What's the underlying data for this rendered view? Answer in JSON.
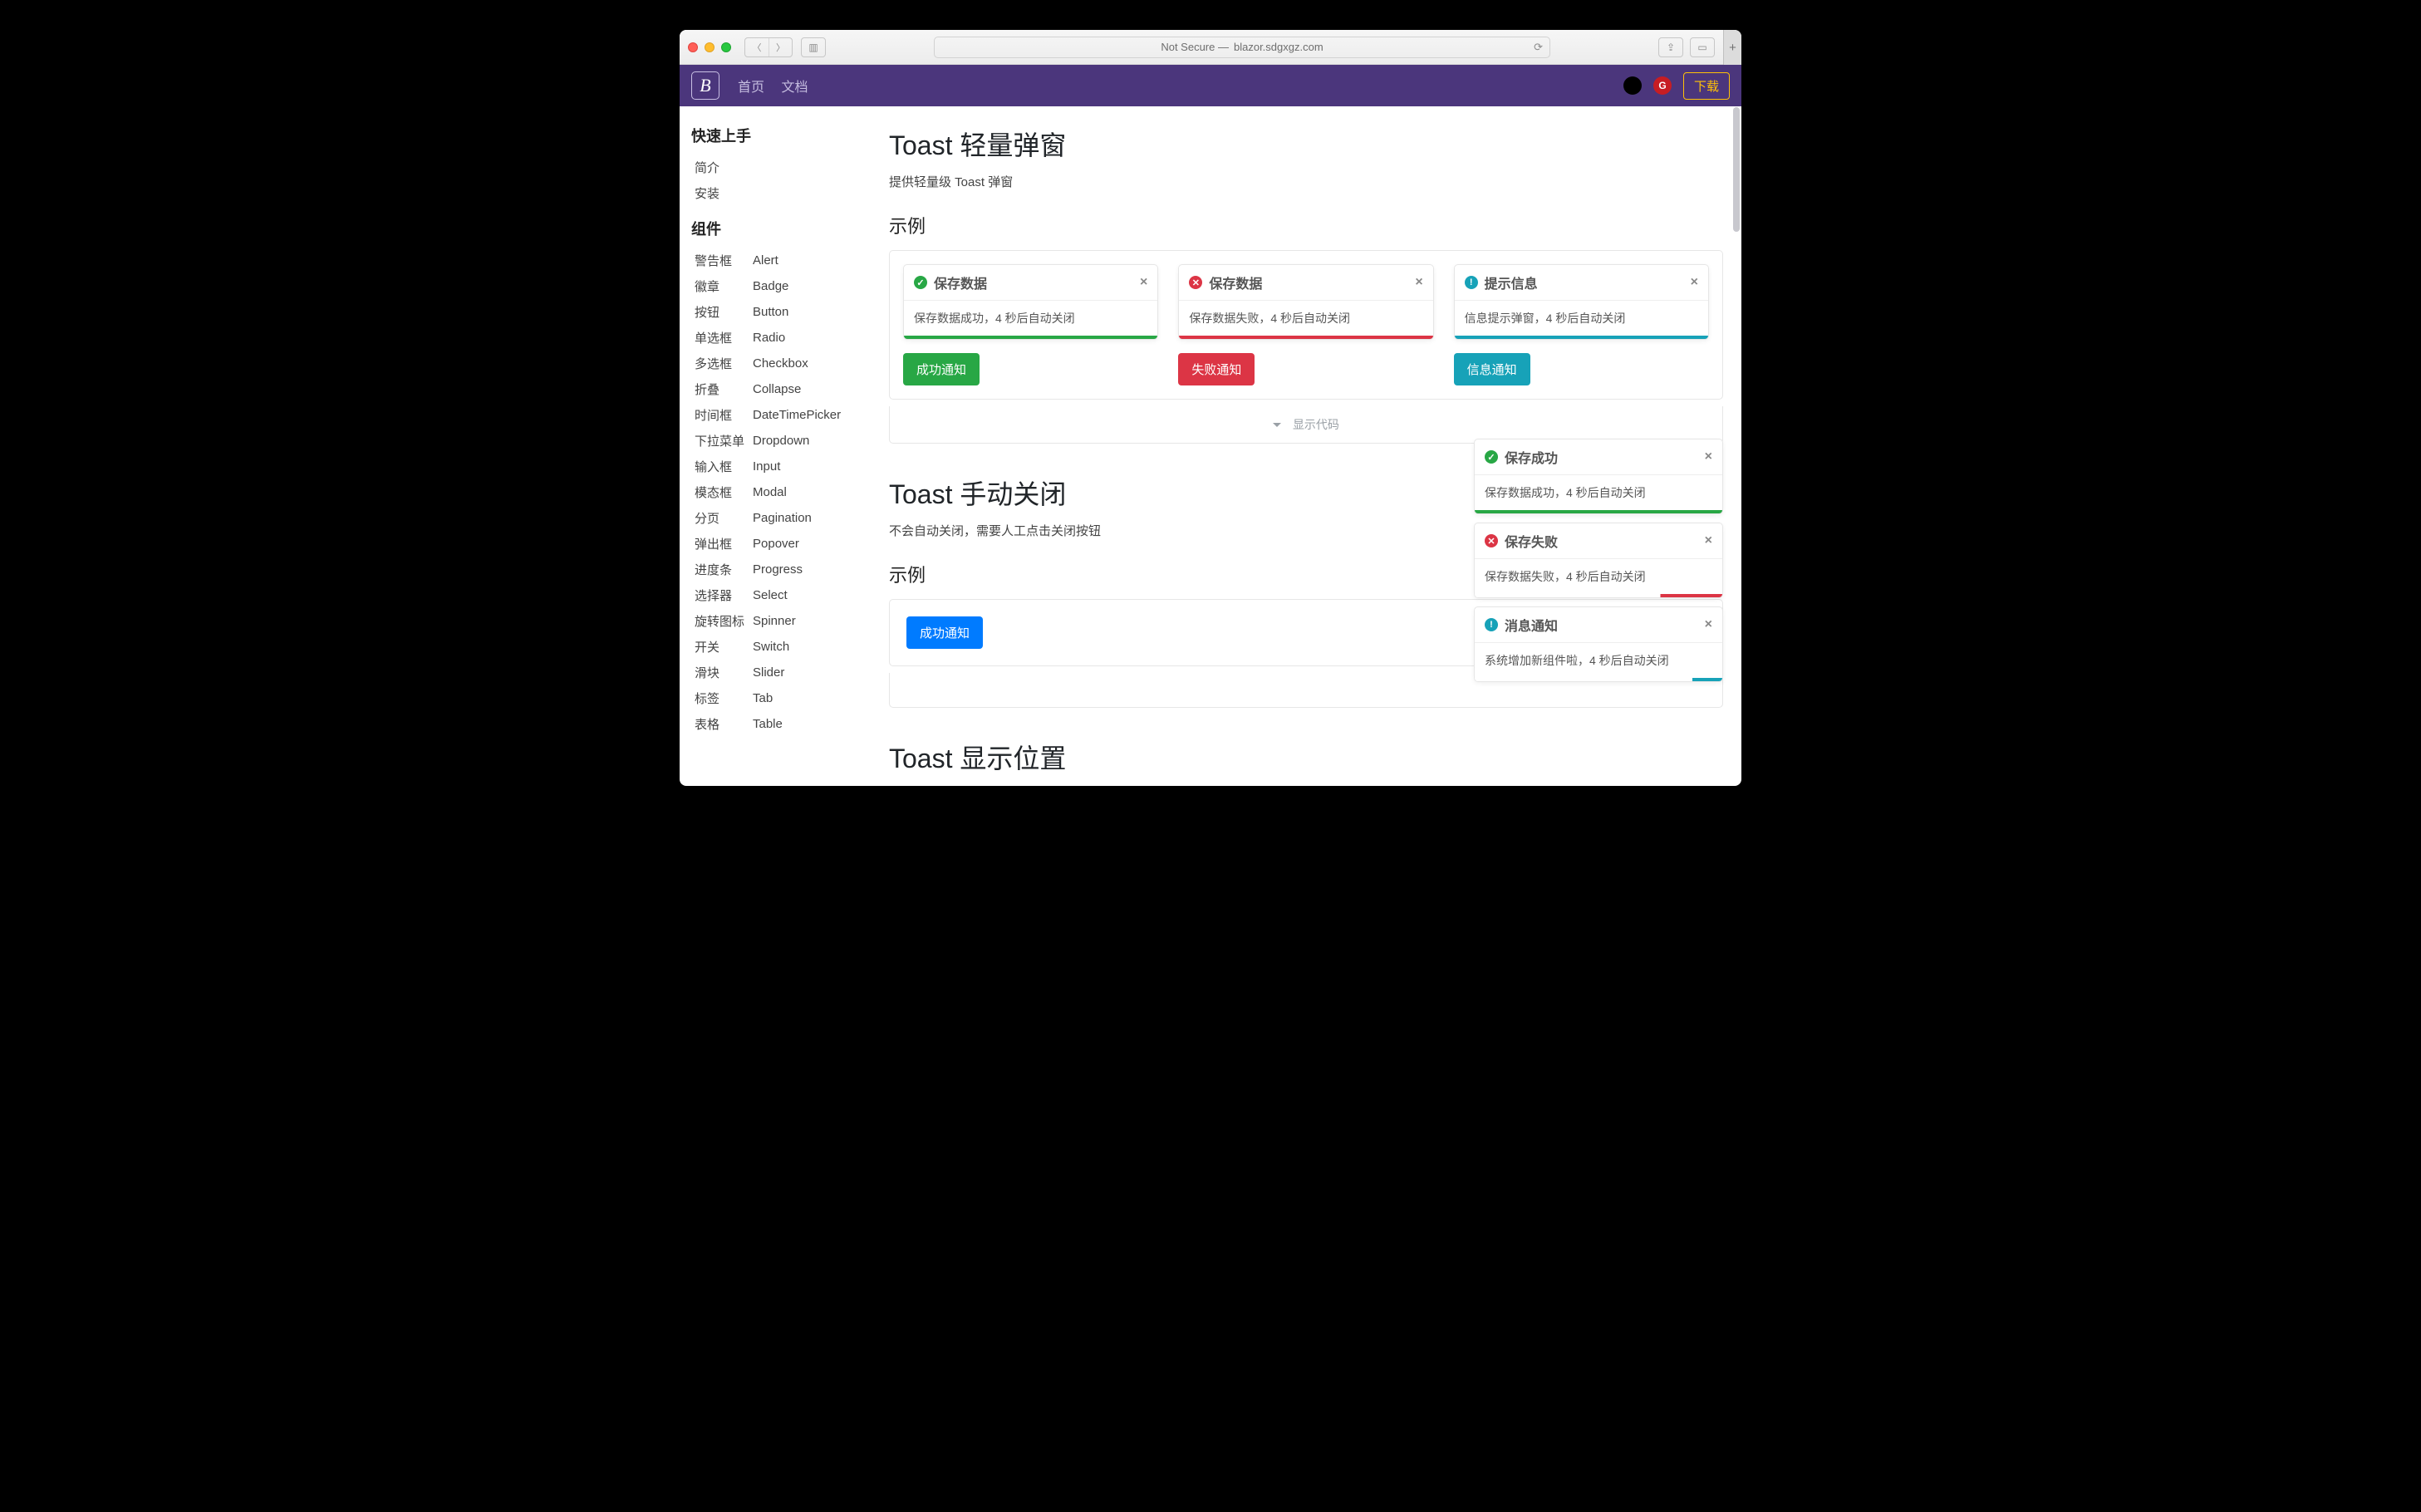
{
  "browser": {
    "address_prefix": "Not Secure —",
    "address_host": "blazor.sdgxgz.com"
  },
  "topbar": {
    "nav_home": "首页",
    "nav_docs": "文档",
    "download": "下载",
    "logo_letter": "B",
    "gitee_letter": "G"
  },
  "sidebar": {
    "group_quickstart": "快速上手",
    "quickstart": [
      {
        "zh": "简介"
      },
      {
        "zh": "安装"
      }
    ],
    "group_components": "组件",
    "components": [
      {
        "zh": "警告框",
        "en": "Alert"
      },
      {
        "zh": "徽章",
        "en": "Badge"
      },
      {
        "zh": "按钮",
        "en": "Button"
      },
      {
        "zh": "单选框",
        "en": "Radio"
      },
      {
        "zh": "多选框",
        "en": "Checkbox"
      },
      {
        "zh": "折叠",
        "en": "Collapse"
      },
      {
        "zh": "时间框",
        "en": "DateTimePicker"
      },
      {
        "zh": "下拉菜单",
        "en": "Dropdown"
      },
      {
        "zh": "输入框",
        "en": "Input"
      },
      {
        "zh": "模态框",
        "en": "Modal"
      },
      {
        "zh": "分页",
        "en": "Pagination"
      },
      {
        "zh": "弹出框",
        "en": "Popover"
      },
      {
        "zh": "进度条",
        "en": "Progress"
      },
      {
        "zh": "选择器",
        "en": "Select"
      },
      {
        "zh": "旋转图标",
        "en": "Spinner"
      },
      {
        "zh": "开关",
        "en": "Switch"
      },
      {
        "zh": "滑块",
        "en": "Slider"
      },
      {
        "zh": "标签",
        "en": "Tab"
      },
      {
        "zh": "表格",
        "en": "Table"
      }
    ]
  },
  "s1": {
    "title": "Toast 轻量弹窗",
    "lead": "提供轻量级 Toast 弹窗",
    "sec": "示例",
    "toasts": [
      {
        "title": "保存数据",
        "body": "保存数据成功，4 秒后自动关闭",
        "icon": "ok",
        "btn": "成功通知"
      },
      {
        "title": "保存数据",
        "body": "保存数据失败，4 秒后自动关闭",
        "icon": "err",
        "btn": "失败通知"
      },
      {
        "title": "提示信息",
        "body": "信息提示弹窗，4 秒后自动关闭",
        "icon": "info",
        "btn": "信息通知"
      }
    ],
    "showcode": "显示代码"
  },
  "s2": {
    "title": "Toast 手动关闭",
    "lead": "不会自动关闭，需要人工点击关闭按钮",
    "sec": "示例",
    "btn": "成功通知"
  },
  "s3": {
    "title": "Toast 显示位置"
  },
  "float": [
    {
      "title": "保存成功",
      "body": "保存数据成功，4 秒后自动关闭",
      "icon": "ok",
      "bar": "ok"
    },
    {
      "title": "保存失败",
      "body": "保存数据失败，4 秒后自动关闭",
      "icon": "err",
      "bar": "partial-err"
    },
    {
      "title": "消息通知",
      "body": "系统增加新组件啦，4 秒后自动关闭",
      "icon": "info",
      "bar": "partial-info"
    }
  ],
  "glyph": {
    "check": "✓",
    "cross": "✕",
    "info": "!"
  }
}
